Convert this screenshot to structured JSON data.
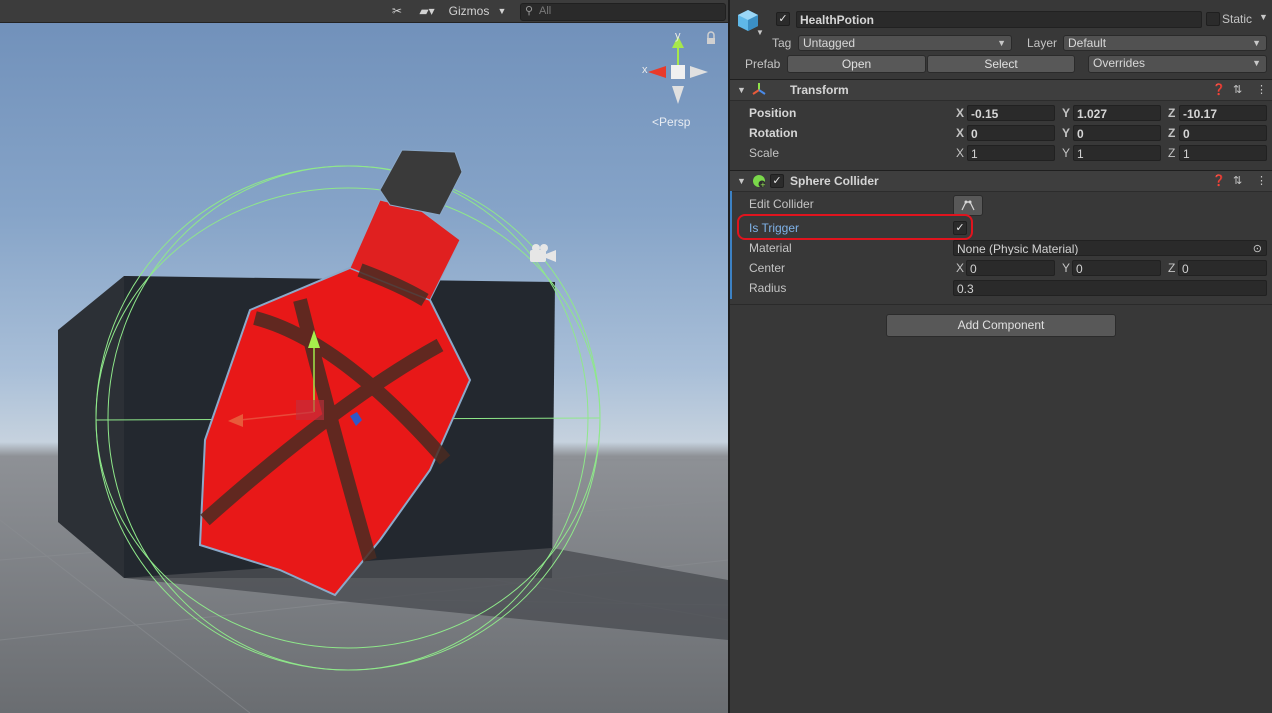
{
  "scene_toolbar": {
    "tools_icon": "tools-icon",
    "camera_icon": "camera-icon",
    "gizmos_label": "Gizmos",
    "search_placeholder": "All"
  },
  "scene_view": {
    "projection_label": "Persp",
    "gizmo_y_label": "y",
    "gizmo_x_label": "x"
  },
  "inspector": {
    "object_name": "HealthPotion",
    "object_active": true,
    "static_label": "Static",
    "tag_label": "Tag",
    "tag_value": "Untagged",
    "layer_label": "Layer",
    "layer_value": "Default",
    "prefab_label": "Prefab",
    "prefab_open": "Open",
    "prefab_select": "Select",
    "prefab_overrides": "Overrides",
    "transform": {
      "title": "Transform",
      "position_label": "Position",
      "rotation_label": "Rotation",
      "scale_label": "Scale",
      "position": {
        "x": "-0.15",
        "y": "1.027",
        "z": "-10.17"
      },
      "rotation": {
        "x": "0",
        "y": "0",
        "z": "0"
      },
      "scale": {
        "x": "1",
        "y": "1",
        "z": "1"
      },
      "axis_x": "X",
      "axis_y": "Y",
      "axis_z": "Z"
    },
    "sphere_collider": {
      "title": "Sphere Collider",
      "enabled": true,
      "edit_collider_label": "Edit Collider",
      "is_trigger_label": "Is Trigger",
      "is_trigger": true,
      "material_label": "Material",
      "material_value": "None (Physic Material)",
      "center_label": "Center",
      "center": {
        "x": "0",
        "y": "0",
        "z": "0"
      },
      "radius_label": "Radius",
      "radius_value": "0.3"
    },
    "add_component_label": "Add Component"
  },
  "colors": {
    "highlight_red": "#e0141e",
    "accent_blue": "#3d82c4",
    "potion_red": "#e81818",
    "collider_green": "#8fe88a"
  }
}
